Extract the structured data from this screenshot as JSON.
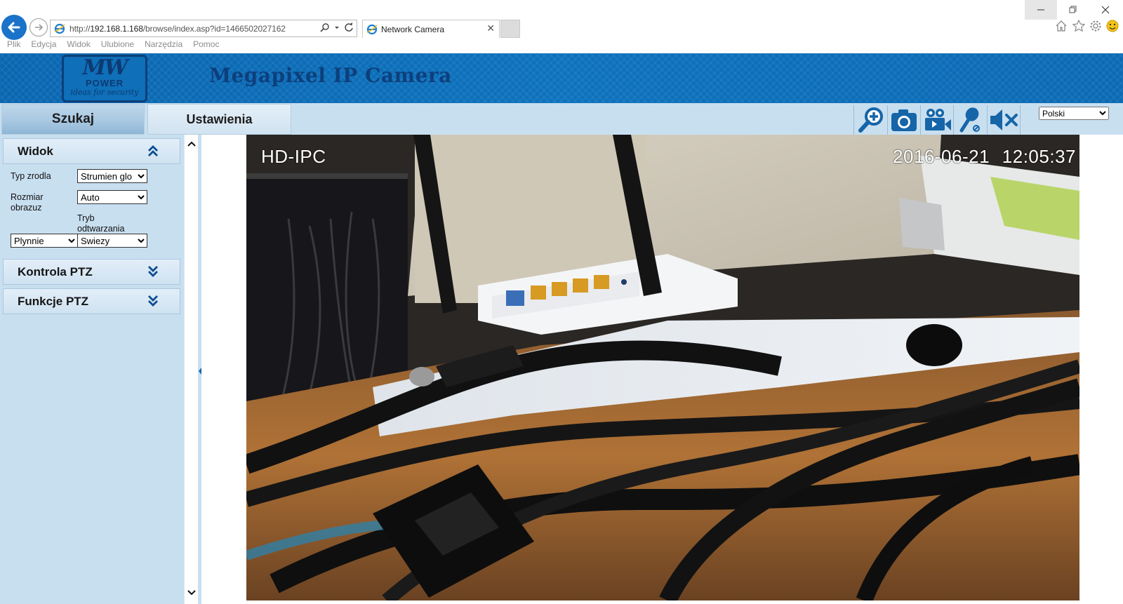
{
  "browser": {
    "url_prefix": "http://",
    "url_host": "192.168.1.168",
    "url_path": "/browse/index.asp?id=1466502027162",
    "tab_title": "Network Camera",
    "menu": [
      "Plik",
      "Edycja",
      "Widok",
      "Ulubione",
      "Narzędzia",
      "Pomoc"
    ]
  },
  "header": {
    "logo_main": "MW",
    "logo_sub": "POWER",
    "logo_tagline": "ideas for security",
    "title": "Megapixel IP Camera"
  },
  "nav": {
    "tabs": [
      "Szukaj",
      "Ustawienia"
    ],
    "active_tab": "Szukaj"
  },
  "toolbar": {
    "icons": [
      "zoom-in-icon",
      "snapshot-icon",
      "record-icon",
      "microphone-icon",
      "mute-icon"
    ],
    "language": "Polski"
  },
  "sidebar": {
    "view_panel": {
      "title": "Widok",
      "source_type_label": "Typ zrodla",
      "source_type_value": "Strumien glo",
      "image_size_label_1": "Rozmiar",
      "image_size_label_2": "obrazuz",
      "image_size_value": "Auto",
      "playback_mode_label_1": "Tryb",
      "playback_mode_label_2": "odtwarzania",
      "smooth_value": "Plynnie",
      "fresh_value": "Swiezy"
    },
    "ptz_control_title": "Kontrola PTZ",
    "ptz_functions_title": "Funkcje PTZ"
  },
  "video": {
    "osd_name": "HD-IPC",
    "osd_date": "2016-06-21",
    "osd_time": "12:05:37"
  },
  "colors": {
    "banner_blue": "#0b6ab4",
    "panel_bg": "#c8dff0",
    "icon_blue": "#1565a8"
  }
}
